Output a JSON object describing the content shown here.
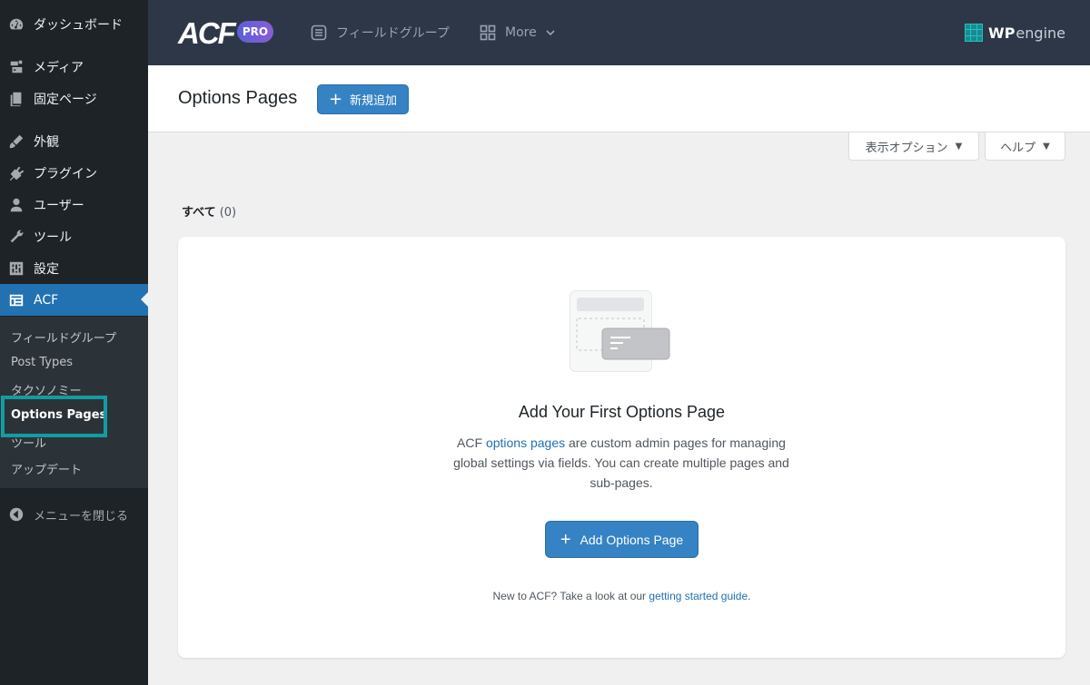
{
  "sidebar": {
    "items": [
      {
        "label": "ダッシュボード",
        "icon": "dashboard-icon"
      },
      {
        "label": "メディア",
        "icon": "media-icon"
      },
      {
        "label": "固定ページ",
        "icon": "pages-icon"
      },
      {
        "label": "外観",
        "icon": "appearance-icon"
      },
      {
        "label": "プラグイン",
        "icon": "plugins-icon"
      },
      {
        "label": "ユーザー",
        "icon": "users-icon"
      },
      {
        "label": "ツール",
        "icon": "tools-icon"
      },
      {
        "label": "設定",
        "icon": "settings-icon"
      },
      {
        "label": "ACF",
        "icon": "acf-icon"
      }
    ],
    "submenu": [
      {
        "label": "フィールドグループ"
      },
      {
        "label": "Post Types"
      },
      {
        "label": "タクソノミー"
      },
      {
        "label": "Options Pages"
      },
      {
        "label": "ツール"
      },
      {
        "label": "アップデート"
      }
    ],
    "collapse_label": "メニューを閉じる"
  },
  "topbar": {
    "logo": "ACF",
    "badge": "PRO",
    "nav_field_groups": "フィールドグループ",
    "nav_more": "More",
    "brand_wp": "WP",
    "brand_engine": "engine"
  },
  "header": {
    "title": "Options Pages",
    "add_new_label": "新規追加",
    "screen_options_label": "表示オプション",
    "help_label": "ヘルプ"
  },
  "filters": {
    "all_label": "すべて",
    "all_count": "(0)"
  },
  "empty_state": {
    "title": "Add Your First Options Page",
    "desc_prefix": "ACF ",
    "desc_link": "options pages",
    "desc_suffix": " are custom admin pages for managing global settings via fields. You can create multiple pages and sub-pages.",
    "button_label": "Add Options Page",
    "note_prefix": "New to ACF? Take a look at our ",
    "note_link": "getting started guide",
    "note_suffix": "."
  },
  "colors": {
    "sidebar_bg": "#1d2327",
    "active_blue": "#2271b1",
    "topbar_bg": "#2d3747",
    "highlight_teal": "#129da3",
    "button_blue": "#3582c4"
  }
}
